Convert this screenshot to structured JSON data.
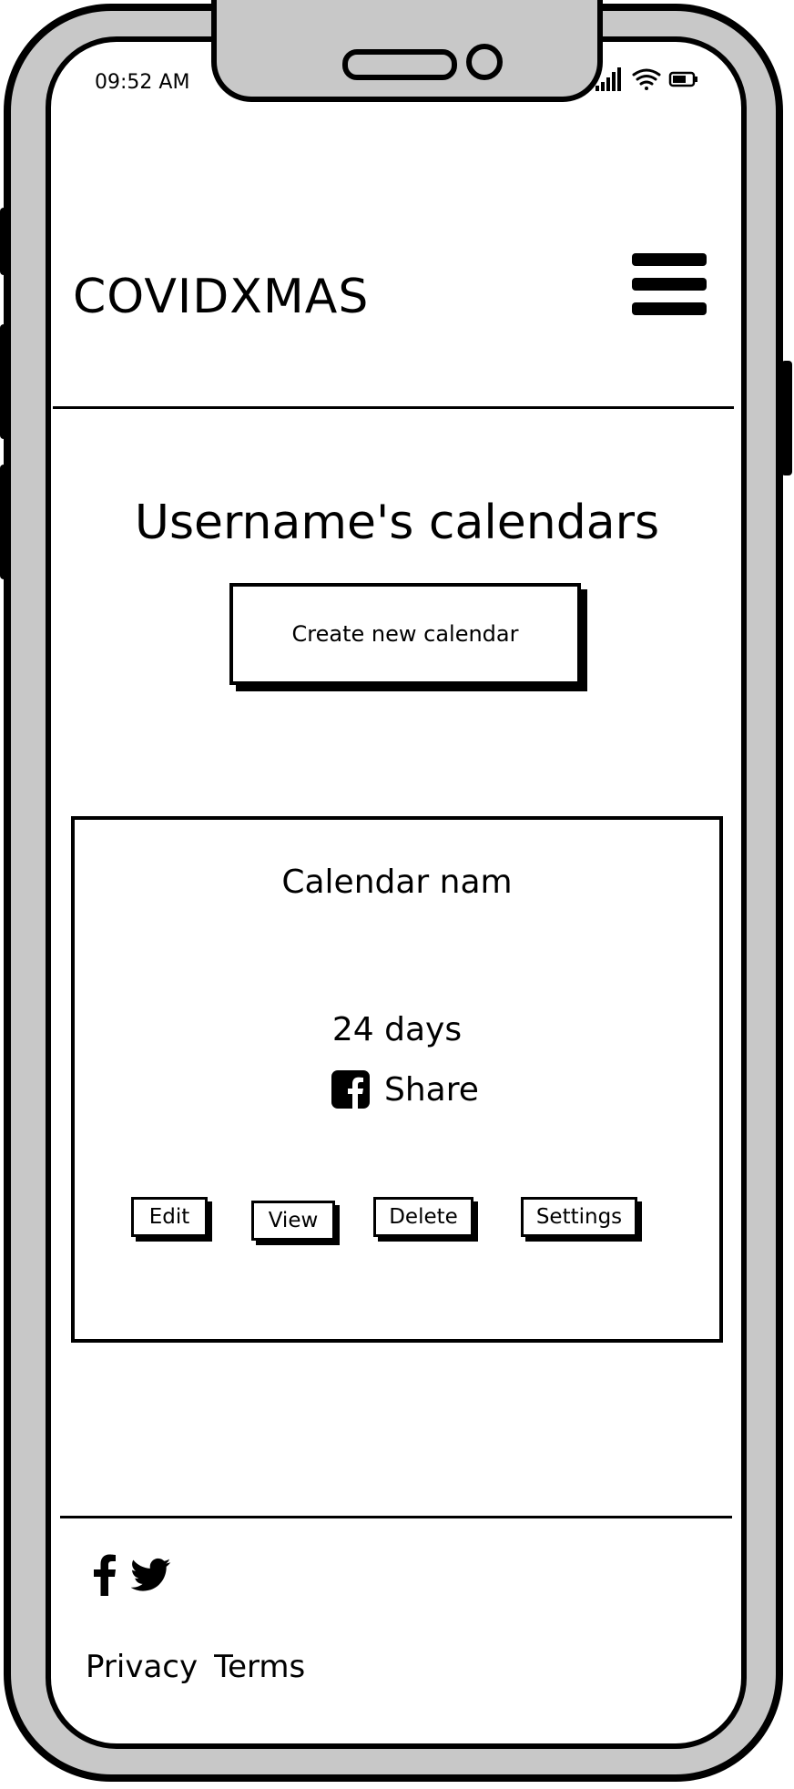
{
  "status_bar": {
    "time": "09:52 AM",
    "icons": [
      "signal-icon",
      "wifi-icon",
      "battery-icon"
    ]
  },
  "header": {
    "brand": "COVIDXMAS",
    "menu_icon": "hamburger-menu-icon"
  },
  "main": {
    "title": "Username's calendars",
    "create_button": "Create new calendar"
  },
  "calendar_card": {
    "name": "Calendar nam",
    "days": "24 days",
    "share_label": "Share",
    "share_icon": "facebook-square-icon",
    "actions": {
      "edit": "Edit",
      "view": "View",
      "delete": "Delete",
      "settings": "Settings"
    }
  },
  "footer": {
    "social_icons": [
      "facebook-icon",
      "twitter-icon"
    ],
    "links": {
      "privacy": "Privacy",
      "terms": "Terms"
    }
  },
  "colors": {
    "ink": "#000000",
    "device_frame": "#c8c8c8",
    "screen": "#ffffff"
  }
}
